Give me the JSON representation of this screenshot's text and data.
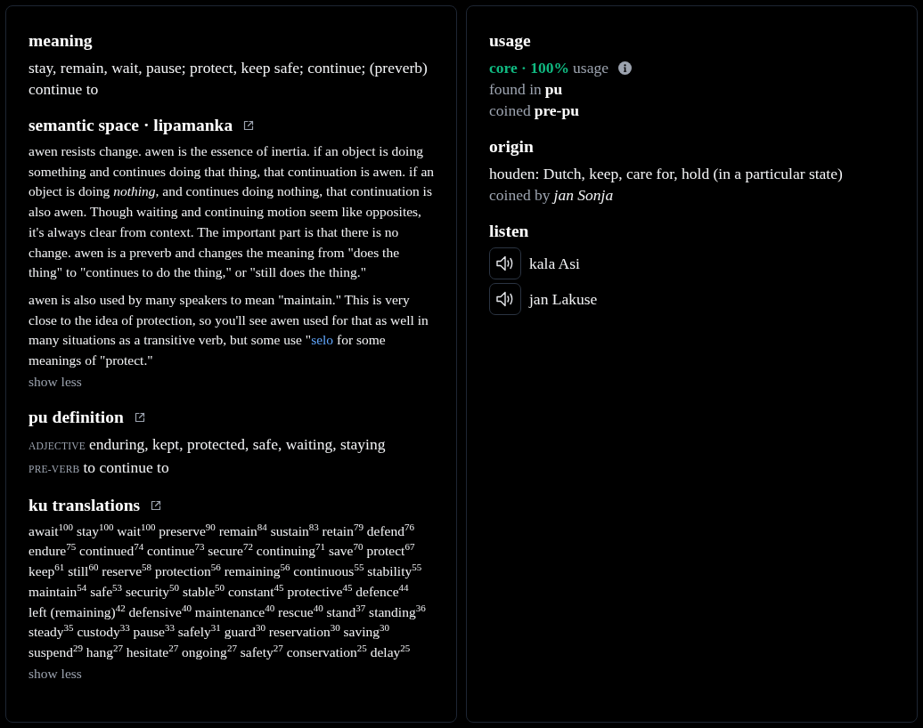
{
  "left_panel": {
    "meaning": {
      "heading": "meaning",
      "text": "stay, remain, wait, pause; protect, keep safe; continue; (preverb) continue to"
    },
    "semantic_space": {
      "heading": "semantic space · lipamanka",
      "link_icon": true,
      "paragraphs": [
        {
          "text": "awen resists change. awen is the essence of inertia. if an object is doing something and continues doing that thing, that continuation is awen. if an object is doing *nothing,* and continues doing nothing, that continuation is also awen. Though waiting and continuing motion seem like opposites, it's always clear from context. The important part is that there is no change. awen is a preverb and changes the meaning from \"does the thing\" to \"continues to do the thing,\" or \"still does the thing.\""
        },
        {
          "text": "awen is also used by many speakers to mean \"maintain.\" This is very close to the idea of protection, so you'll see awen used for that as well in many situations as a transitive verb, but some use \"",
          "link": "selo",
          "text_after": " for some meanings of \"protect.\""
        }
      ],
      "toggle": "show less"
    },
    "pu_definition": {
      "heading": "pu definition",
      "link_icon": true,
      "entries": [
        {
          "pos": "ADJECTIVE",
          "text": "enduring, kept, protected, safe, waiting, staying"
        },
        {
          "pos": "PRE-VERB",
          "text": "to continue to"
        }
      ]
    },
    "ku_translations": {
      "heading": "ku translations",
      "link_icon": true,
      "words": [
        {
          "word": "await",
          "score": "100"
        },
        {
          "word": "stay",
          "score": "100"
        },
        {
          "word": "wait",
          "score": "100"
        },
        {
          "word": "preserve",
          "score": "90"
        },
        {
          "word": "remain",
          "score": "84"
        },
        {
          "word": "sustain",
          "score": "83"
        },
        {
          "word": "retain",
          "score": "79"
        },
        {
          "word": "defend",
          "score": "76"
        },
        {
          "word": "endure",
          "score": "75"
        },
        {
          "word": "continued",
          "score": "74"
        },
        {
          "word": "continue",
          "score": "73"
        },
        {
          "word": "secure",
          "score": "72"
        },
        {
          "word": "continuing",
          "score": "71"
        },
        {
          "word": "save",
          "score": "70"
        },
        {
          "word": "protect",
          "score": "67"
        },
        {
          "word": "keep",
          "score": "61"
        },
        {
          "word": "still",
          "score": "60"
        },
        {
          "word": "reserve",
          "score": "58"
        },
        {
          "word": "protection",
          "score": "56"
        },
        {
          "word": "remaining",
          "score": "56"
        },
        {
          "word": "continuous",
          "score": "55"
        },
        {
          "word": "stability",
          "score": "55"
        },
        {
          "word": "maintain",
          "score": "54"
        },
        {
          "word": "safe",
          "score": "53"
        },
        {
          "word": "security",
          "score": "50"
        },
        {
          "word": "stable",
          "score": "50"
        },
        {
          "word": "constant",
          "score": "45"
        },
        {
          "word": "protective",
          "score": "45"
        },
        {
          "word": "defence",
          "score": "44"
        },
        {
          "word": "left (remaining)",
          "score": "42"
        },
        {
          "word": "defensive",
          "score": "40"
        },
        {
          "word": "maintenance",
          "score": "40"
        },
        {
          "word": "rescue",
          "score": "40"
        },
        {
          "word": "stand",
          "score": "37"
        },
        {
          "word": "standing",
          "score": "36"
        },
        {
          "word": "steady",
          "score": "35"
        },
        {
          "word": "custody",
          "score": "33"
        },
        {
          "word": "pause",
          "score": "33"
        },
        {
          "word": "safely",
          "score": "31"
        },
        {
          "word": "guard",
          "score": "30"
        },
        {
          "word": "reservation",
          "score": "30"
        },
        {
          "word": "saving",
          "score": "30"
        },
        {
          "word": "suspend",
          "score": "29"
        },
        {
          "word": "hang",
          "score": "27"
        },
        {
          "word": "hesitate",
          "score": "27"
        },
        {
          "word": "ongoing",
          "score": "27"
        },
        {
          "word": "safety",
          "score": "27"
        },
        {
          "word": "conservation",
          "score": "25"
        },
        {
          "word": "delay",
          "score": "25"
        }
      ],
      "toggle": "show less"
    }
  },
  "right_panel": {
    "usage": {
      "heading": "usage",
      "category": "core · 100%",
      "label": "usage",
      "details": [
        {
          "label": "found in",
          "value": "pu"
        },
        {
          "label": "coined",
          "value": "pre-pu"
        }
      ]
    },
    "origin": {
      "heading": "origin",
      "text": "houden: Dutch, keep, care for, hold (in a particular state)",
      "coined_by_label": "coined by",
      "coined_by": "jan Sonja"
    },
    "listen": {
      "heading": "listen",
      "speakers": [
        "kala Asi",
        "jan Lakuse"
      ]
    }
  }
}
